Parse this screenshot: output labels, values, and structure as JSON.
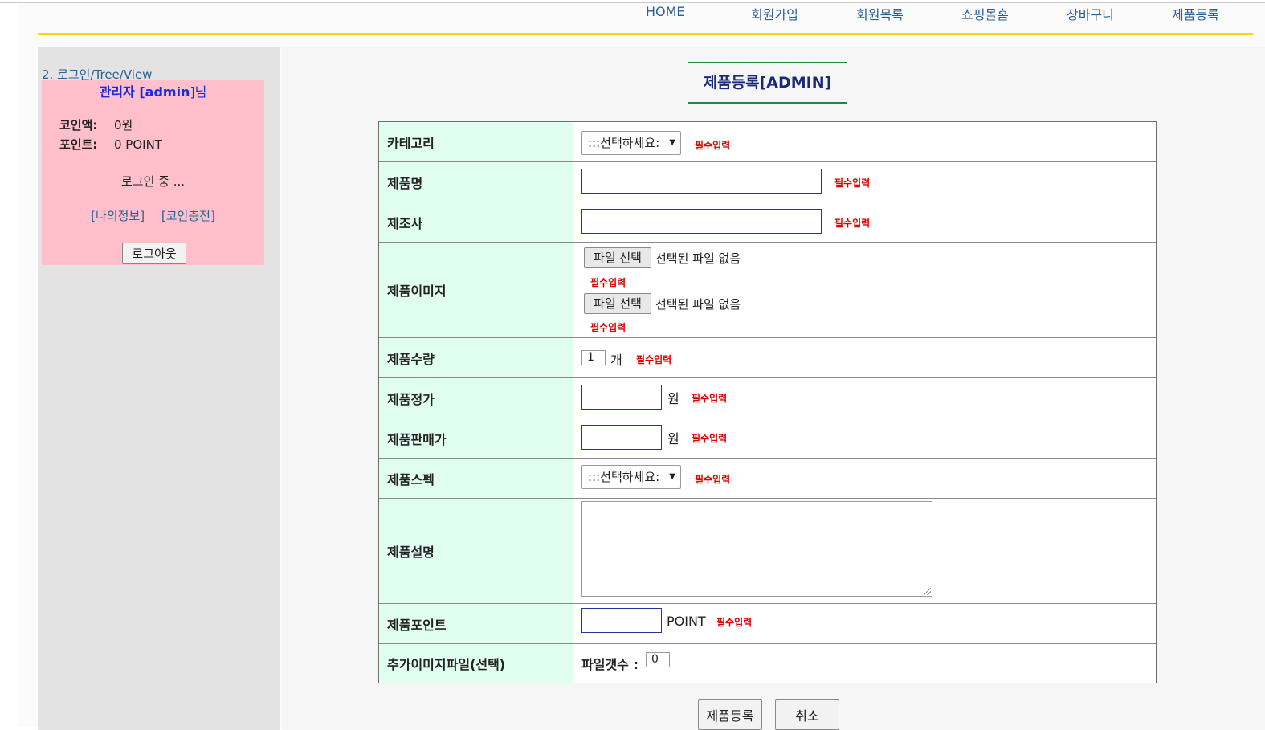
{
  "nav": {
    "items": [
      "HOME",
      "회원가입",
      "회원목록",
      "쇼핑몰홈",
      "장바구니",
      "제품등록"
    ]
  },
  "sidebar": {
    "title": "2. 로그인/Tree/View",
    "admin_prefix": "관리자 [",
    "admin_id": "admin",
    "admin_suffix": "]님",
    "coin_label": "코인액:",
    "coin_value": "0원",
    "point_label": "포인트:",
    "point_value": "0 POINT",
    "status": "로그인 중 ...",
    "link_myinfo": "[나의정보]",
    "link_charge": "[코인충전]",
    "logout": "로그아웃"
  },
  "main": {
    "title": "제품등록[ADMIN]",
    "required": "필수입력",
    "select_placeholder": ":::선택하세요:",
    "file_button": "파일 선택",
    "file_none": "선택된 파일 없음",
    "labels": {
      "category": "카테고리",
      "name": "제품명",
      "maker": "제조사",
      "image": "제품이미지",
      "qty": "제품수량",
      "price": "제품정가",
      "sale": "제품판매가",
      "spec": "제품스펙",
      "desc": "제품설명",
      "point": "제품포인트",
      "extra": "추가이미지파일(선택)"
    },
    "qty_value": "1",
    "qty_unit": "개",
    "won_unit": "원",
    "point_unit": "POINT",
    "file_count_label": "파일갯수 :",
    "file_count_value": "0",
    "submit": "제품등록",
    "cancel": "취소"
  }
}
